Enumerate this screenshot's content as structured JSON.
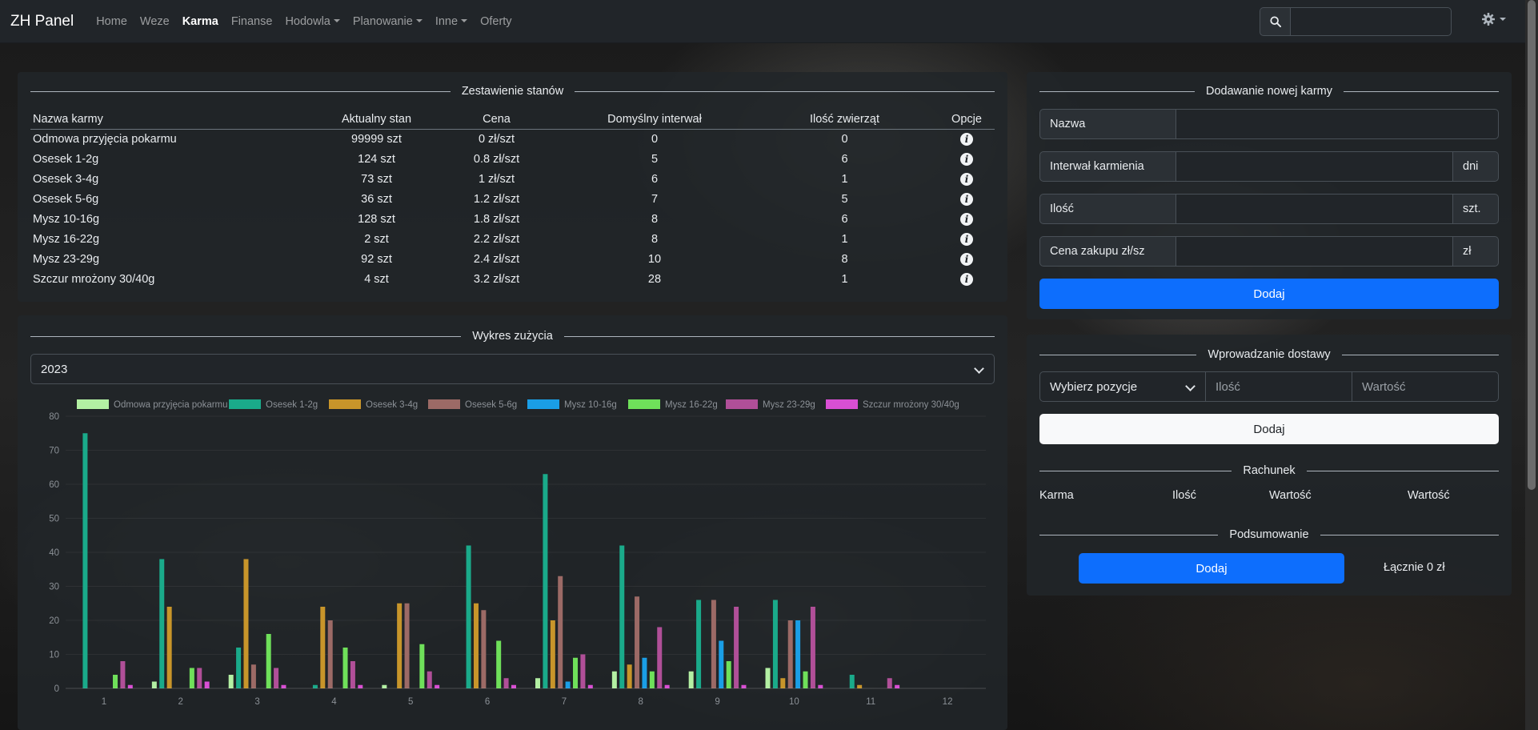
{
  "navbar": {
    "brand": "ZH Panel",
    "links": [
      {
        "label": "Home",
        "active": false,
        "dropdown": false
      },
      {
        "label": "Weze",
        "active": false,
        "dropdown": false
      },
      {
        "label": "Karma",
        "active": true,
        "dropdown": false
      },
      {
        "label": "Finanse",
        "active": false,
        "dropdown": false
      },
      {
        "label": "Hodowla",
        "active": false,
        "dropdown": true
      },
      {
        "label": "Planowanie",
        "active": false,
        "dropdown": true
      },
      {
        "label": "Inne",
        "active": false,
        "dropdown": true
      },
      {
        "label": "Oferty",
        "active": false,
        "dropdown": false
      }
    ],
    "search_value": ""
  },
  "stock": {
    "title": "Zestawienie stanów",
    "columns": [
      "Nazwa karmy",
      "Aktualny stan",
      "Cena",
      "Domyślny interwał",
      "Ilość zwierząt",
      "Opcje"
    ],
    "rows": [
      [
        "Odmowa przyjęcia pokarmu",
        "99999 szt",
        "0 zł/szt",
        "0",
        "0"
      ],
      [
        "Osesek 1-2g",
        "124 szt",
        "0.8 zł/szt",
        "5",
        "6"
      ],
      [
        "Osesek 3-4g",
        "73 szt",
        "1 zł/szt",
        "6",
        "1"
      ],
      [
        "Osesek 5-6g",
        "36 szt",
        "1.2 zł/szt",
        "7",
        "5"
      ],
      [
        "Mysz 10-16g",
        "128 szt",
        "1.8 zł/szt",
        "8",
        "6"
      ],
      [
        "Mysz 16-22g",
        "2 szt",
        "2.2 zł/szt",
        "8",
        "1"
      ],
      [
        "Mysz 23-29g",
        "92 szt",
        "2.4 zł/szt",
        "10",
        "8"
      ],
      [
        "Szczur mrożony 30/40g",
        "4 szt",
        "3.2 zł/szt",
        "28",
        "1"
      ]
    ]
  },
  "usage": {
    "title": "Wykres zużycia",
    "year_selected": "2023"
  },
  "chart_data": {
    "type": "bar",
    "categories": [
      "1",
      "2",
      "3",
      "4",
      "5",
      "6",
      "7",
      "8",
      "9",
      "10",
      "11",
      "12"
    ],
    "ylim": [
      0,
      80
    ],
    "yticks": [
      0,
      10,
      20,
      30,
      40,
      50,
      60,
      70,
      80
    ],
    "legend_position": "top",
    "series": [
      {
        "name": "Odmowa przyjęcia pokarmu",
        "color": "#b3f0a3",
        "values": [
          0,
          2,
          4,
          0,
          1,
          0,
          3,
          5,
          5,
          6,
          0,
          0
        ]
      },
      {
        "name": "Osesek 1-2g",
        "color": "#1aaa8a",
        "values": [
          75,
          38,
          12,
          1,
          0,
          42,
          63,
          42,
          26,
          26,
          4,
          0
        ]
      },
      {
        "name": "Osesek 3-4g",
        "color": "#c8952a",
        "values": [
          0,
          24,
          38,
          24,
          25,
          25,
          20,
          7,
          0,
          3,
          1,
          0
        ]
      },
      {
        "name": "Osesek 5-6g",
        "color": "#9c6a66",
        "values": [
          0,
          0,
          7,
          20,
          25,
          23,
          33,
          27,
          26,
          20,
          0,
          0
        ]
      },
      {
        "name": "Mysz 10-16g",
        "color": "#1a9ee6",
        "values": [
          0,
          0,
          0,
          0,
          0,
          0,
          2,
          9,
          14,
          20,
          0,
          0
        ]
      },
      {
        "name": "Mysz 16-22g",
        "color": "#6fe05a",
        "values": [
          4,
          6,
          16,
          12,
          13,
          14,
          9,
          5,
          8,
          5,
          0,
          0
        ]
      },
      {
        "name": "Mysz 23-29g",
        "color": "#b04f98",
        "values": [
          8,
          6,
          6,
          8,
          5,
          3,
          10,
          18,
          24,
          24,
          3,
          0
        ]
      },
      {
        "name": "Szczur mrożony 30/40g",
        "color": "#d94fd4",
        "values": [
          1,
          2,
          1,
          1,
          1,
          1,
          1,
          1,
          1,
          1,
          1,
          0
        ]
      }
    ]
  },
  "add_feed": {
    "title": "Dodawanie nowej karmy",
    "name_label": "Nazwa",
    "interval_label": "Interwał karmienia",
    "interval_suffix": "dni",
    "quantity_label": "Ilość",
    "quantity_suffix": "szt.",
    "price_label": "Cena zakupu zł/sz",
    "price_suffix": "zł",
    "submit_label": "Dodaj"
  },
  "delivery": {
    "title": "Wprowadzanie dostawy",
    "select_placeholder": "Wybierz pozycje",
    "quantity_placeholder": "Ilość",
    "value_placeholder": "Wartość",
    "add_label": "Dodaj",
    "bill_title": "Rachunek",
    "bill_columns": [
      "Karma",
      "Ilość",
      "Wartość",
      "Wartość"
    ],
    "summary_title": "Podsumowanie",
    "summary_button": "Dodaj",
    "total_label": "Łącznie 0 zł"
  }
}
